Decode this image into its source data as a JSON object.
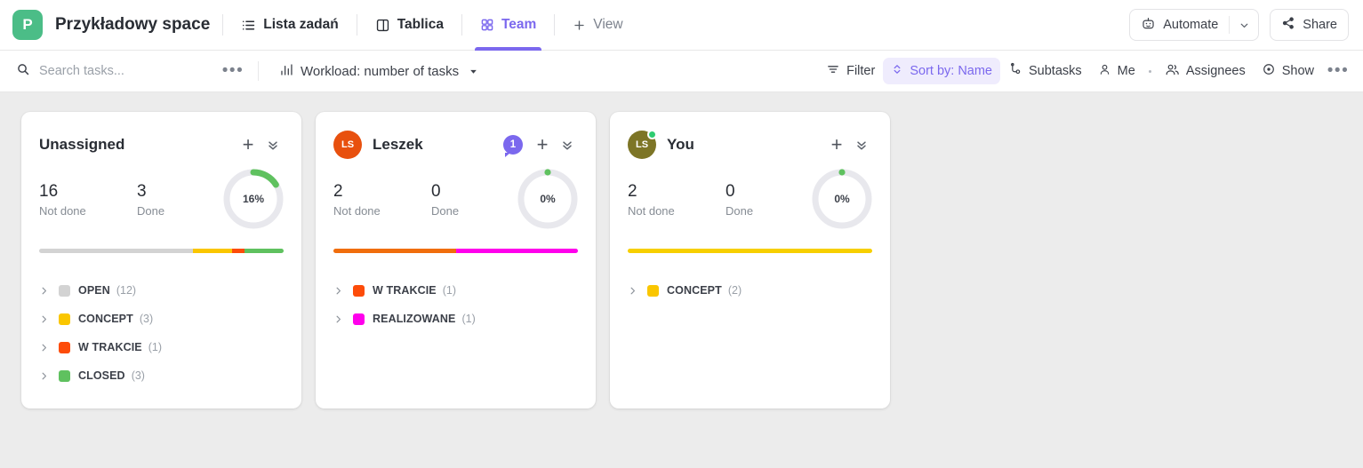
{
  "header": {
    "space_initial": "P",
    "space_initial_color": "#4bbd87",
    "space_title": "Przykładowy space",
    "tabs": [
      {
        "label": "Lista zadań",
        "icon": "list-icon",
        "active": false
      },
      {
        "label": "Tablica",
        "icon": "board-icon",
        "active": false
      },
      {
        "label": "Team",
        "icon": "grid-icon",
        "active": true
      }
    ],
    "add_view_label": "View",
    "automate_label": "Automate",
    "share_label": "Share",
    "accent_color": "#7b68ee"
  },
  "toolbar": {
    "search_placeholder": "Search tasks...",
    "search_value": "",
    "workload_label": "Workload: number of tasks",
    "filter_label": "Filter",
    "sort_label": "Sort by: Name",
    "subtasks_label": "Subtasks",
    "me_label": "Me",
    "assignees_label": "Assignees",
    "show_label": "Show"
  },
  "cards": [
    {
      "name": "Unassigned",
      "has_avatar": false,
      "avatar_initials": "",
      "avatar_color": "",
      "online": false,
      "badge": null,
      "not_done": "16",
      "not_done_label": "Not done",
      "done": "3",
      "done_label": "Done",
      "percent_label": "16%",
      "percent_value": 16,
      "donut_color": "#5fc15f",
      "segments": [
        {
          "color": "#d3d3d3",
          "pct": 63
        },
        {
          "color": "#fac600",
          "pct": 16
        },
        {
          "color": "#fd4c09",
          "pct": 5
        },
        {
          "color": "#5fc15f",
          "pct": 16
        }
      ],
      "statuses": [
        {
          "name": "OPEN",
          "count": "(12)",
          "color": "#d3d3d3"
        },
        {
          "name": "CONCEPT",
          "count": "(3)",
          "color": "#fac600"
        },
        {
          "name": "W TRAKCIE",
          "count": "(1)",
          "color": "#fd4c09"
        },
        {
          "name": "CLOSED",
          "count": "(3)",
          "color": "#5fc15f"
        }
      ]
    },
    {
      "name": "Leszek",
      "has_avatar": true,
      "avatar_initials": "LS",
      "avatar_color": "#e8500e",
      "online": false,
      "badge": "1",
      "not_done": "2",
      "not_done_label": "Not done",
      "done": "0",
      "done_label": "Done",
      "percent_label": "0%",
      "percent_value": 0,
      "donut_color": "#5fc15f",
      "segments": [
        {
          "color": "#f06d0c",
          "pct": 50
        },
        {
          "color": "#ff00ec",
          "pct": 50
        }
      ],
      "statuses": [
        {
          "name": "W TRAKCIE",
          "count": "(1)",
          "color": "#fd4c09"
        },
        {
          "name": "REALIZOWANE",
          "count": "(1)",
          "color": "#ff00ec"
        }
      ]
    },
    {
      "name": "You",
      "has_avatar": true,
      "avatar_initials": "LS",
      "avatar_color": "#7d7526",
      "online": true,
      "badge": null,
      "not_done": "2",
      "not_done_label": "Not done",
      "done": "0",
      "done_label": "Done",
      "percent_label": "0%",
      "percent_value": 0,
      "donut_color": "#5fc15f",
      "segments": [
        {
          "color": "#f7cf00",
          "pct": 100
        }
      ],
      "statuses": [
        {
          "name": "CONCEPT",
          "count": "(2)",
          "color": "#fac600"
        }
      ]
    }
  ]
}
